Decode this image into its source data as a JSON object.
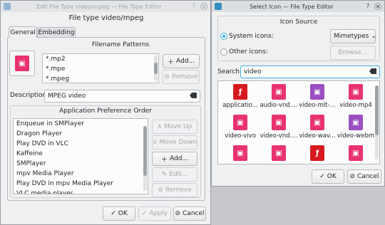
{
  "left_window": {
    "title": "Edit File Type video/mpeg — File Type Editor",
    "heading": "File type video/mpeg",
    "tabs": [
      {
        "label": "General"
      },
      {
        "label": "Embedding"
      }
    ],
    "filename_patterns": {
      "title": "Filename Patterns",
      "items": [
        "*.mp2",
        "*.mpe",
        "*.mpeg"
      ],
      "add_label": "Add...",
      "remove_label": "Remove"
    },
    "description": {
      "label": "Description:",
      "value": "MPEG video"
    },
    "app_pref": {
      "title": "Application Preference Order",
      "items": [
        "Enqueue in SMPlayer",
        "Dragon Player",
        "Play DVD in VLC",
        "Kaffeine",
        "SMPlayer",
        "mpv Media Player",
        "Play DVD in mpv Media Player",
        "VLC media player"
      ],
      "move_up_label": "Move Up",
      "move_down_label": "Move Down",
      "add_label": "Add...",
      "edit_label": "Edit...",
      "remove_label": "Remove"
    },
    "ok_label": "OK",
    "apply_label": "Apply",
    "cancel_label": "Cancel"
  },
  "right_window": {
    "title": "Select Icon — File Type Editor",
    "icon_source": {
      "title": "Icon Source",
      "system_label": "System icons:",
      "other_label": "Other icons:",
      "category_value": "Mimetypes",
      "browse_label": "Browse..."
    },
    "search": {
      "label": "Search:",
      "value": "video"
    },
    "icons": [
      {
        "label": "applicatio...",
        "color": "#d71a20",
        "glyph": "ƒ"
      },
      {
        "label": "audio-vnd....",
        "color": "#e8336f",
        "glyph": "▣"
      },
      {
        "label": "video-mlt-...",
        "color": "#9b4fc2",
        "glyph": "▣"
      },
      {
        "label": "video-mp4",
        "color": "#e8336f",
        "glyph": "▣"
      },
      {
        "label": "video-vivo",
        "color": "#e8336f",
        "glyph": "▣"
      },
      {
        "label": "video-vnd....",
        "color": "#e8336f",
        "glyph": "▣"
      },
      {
        "label": "video-wav...",
        "color": "#e8336f",
        "glyph": "▣"
      },
      {
        "label": "video-webm",
        "color": "#9b4fc2",
        "glyph": "▣"
      },
      {
        "label": "",
        "color": "#e8336f",
        "glyph": "▣"
      },
      {
        "label": "",
        "color": "#e8336f",
        "glyph": "▣"
      },
      {
        "label": "",
        "color": "#d71a20",
        "glyph": "ƒ"
      },
      {
        "label": "",
        "color": "#e8336f",
        "glyph": "▣"
      }
    ],
    "ok_label": "OK",
    "cancel_label": "Cancel"
  },
  "colors": {
    "mime_pink": "#e8336f",
    "accent": "#3daee9"
  }
}
